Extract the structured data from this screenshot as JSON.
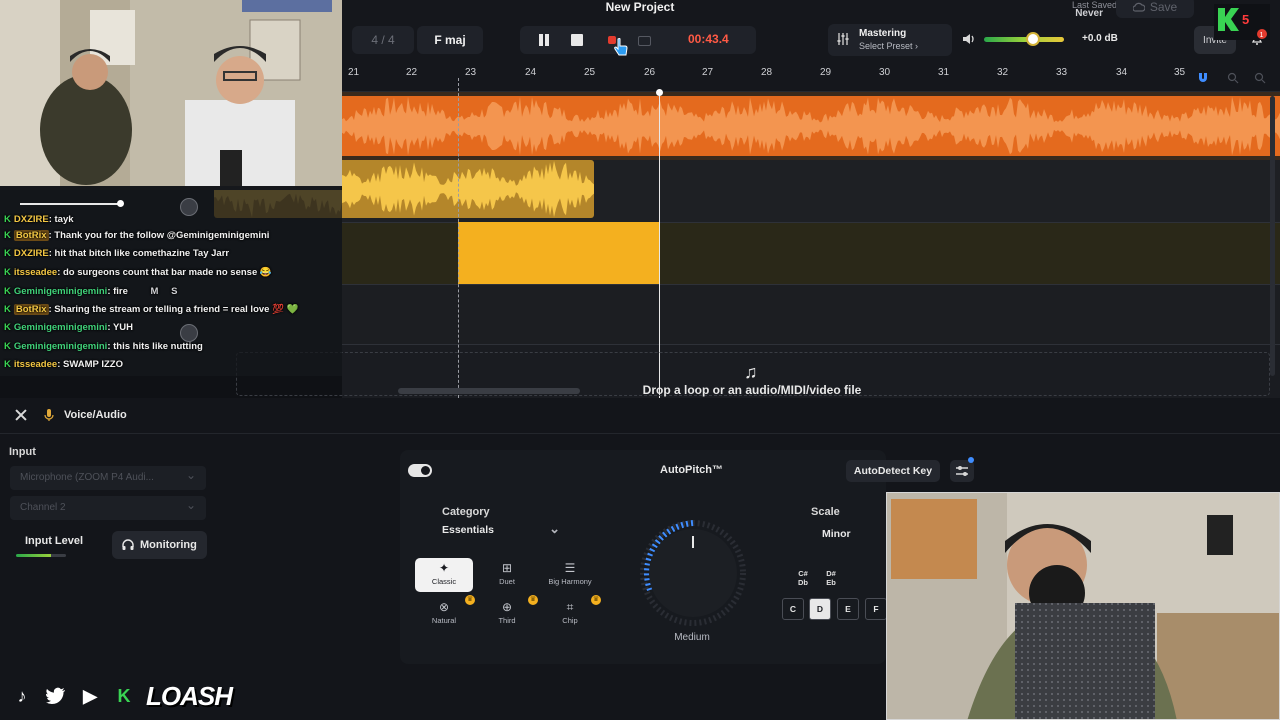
{
  "header": {
    "project_title": "New Project",
    "bars": "4 / 4",
    "key": "F maj",
    "time": "00:43.4",
    "mastering_title": "Mastering",
    "mastering_preset": "Select Preset ›",
    "volume_db": "+0.0 dB",
    "last_saved_label": "Last Saved",
    "last_saved_value": "Never",
    "save_label": "Save",
    "invite_label": "Invite",
    "badge_count": "5"
  },
  "ruler": {
    "ticks": [
      "21",
      "22",
      "23",
      "24",
      "25",
      "26",
      "27",
      "28",
      "29",
      "30",
      "31",
      "32",
      "33",
      "34",
      "35"
    ]
  },
  "arrange": {
    "drop_text": "Drop a loop or an audio/MIDI/video file"
  },
  "chat": {
    "lines": [
      {
        "user": "DXZIRE",
        "text": ": tayk"
      },
      {
        "user": "BotRix",
        "text": ": Thank you for the follow @Geminigeminigemini"
      },
      {
        "user": "DXZIRE",
        "text": ": hit that bitch like comethazine Tay Jarr"
      },
      {
        "user": "itsseadee",
        "text": ": do surgeons count that bar made no sense 😂"
      },
      {
        "user": "Geminigeminigemini",
        "text": ": fire"
      },
      {
        "user": "BotRix",
        "text": ": Sharing the stream or telling a friend = real love 💯 💚"
      },
      {
        "user": "Geminigeminigemini",
        "text": ": YUH"
      },
      {
        "user": "Geminigeminigemini",
        "text": ": this hits like nutting"
      },
      {
        "user": "itsseadee",
        "text": ": SWAMP IZZO"
      }
    ],
    "track_label_1": "Voice/Audio",
    "track_label_2": "Voice/Audio",
    "mute": "M",
    "solo": "S"
  },
  "editor": {
    "track_title": "Voice/Audio",
    "input_label": "Input",
    "input_device": "Microphone (ZOOM P4 Audi...",
    "input_channel": "Channel 2",
    "input_level_label": "Input Level",
    "monitoring_label": "Monitoring",
    "plugin_title": "AutoPitch™",
    "autodetect_label": "AutoDetect Key",
    "category_label": "Category",
    "category_value": "Essentials",
    "presets": [
      "Classic",
      "Duet",
      "Big Harmony",
      "Natural",
      "Third",
      "Chip"
    ],
    "knob_label": "Medium",
    "scale_label": "Scale",
    "scale_value": "Minor",
    "sharps": [
      "C#\nDb",
      "D#\nEb"
    ],
    "notes": [
      "C",
      "D",
      "E",
      "F"
    ]
  },
  "overlay": {
    "channel_name": "LOASH"
  },
  "colors": {
    "accent_orange": "#e46a1e",
    "clip_yellow": "#f4b01f",
    "record_red": "#ff5a45"
  }
}
